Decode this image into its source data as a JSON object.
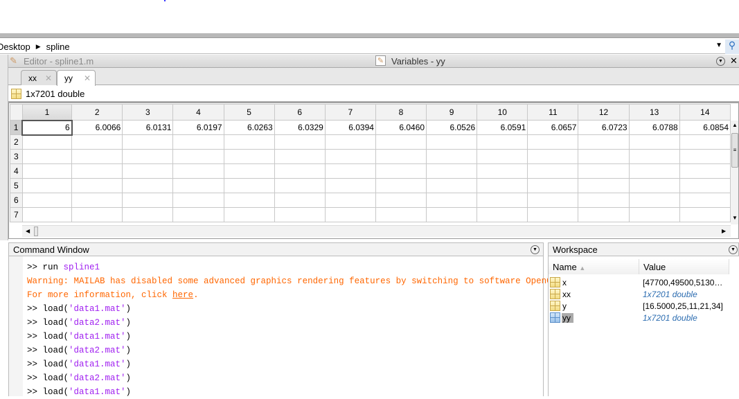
{
  "address": {
    "parts": [
      "Desktop",
      "spline"
    ]
  },
  "editor": {
    "title": "Editor - spline1.m",
    "variables_title": "Variables - yy"
  },
  "tabs": [
    {
      "label": "xx"
    },
    {
      "label": "yy"
    }
  ],
  "variable": {
    "info": "1x7201 double"
  },
  "grid": {
    "columns": [
      "1",
      "2",
      "3",
      "4",
      "5",
      "6",
      "7",
      "8",
      "9",
      "10",
      "11",
      "12",
      "13",
      "14"
    ],
    "rows": [
      "1",
      "2",
      "3",
      "4",
      "5",
      "6",
      "7"
    ],
    "row1": [
      "6",
      "6.0066",
      "6.0131",
      "6.0197",
      "6.0263",
      "6.0329",
      "6.0394",
      "6.0460",
      "6.0526",
      "6.0591",
      "6.0657",
      "6.0723",
      "6.0788",
      "6.0854"
    ]
  },
  "command_window": {
    "title": "Command Window",
    "lines": [
      {
        "prompt": ">> ",
        "cmd": "run ",
        "arg": "spline1"
      },
      {
        "warn": "Warning: MAILAB has disabled some advanced graphics rendering features by switching to software OpenGL."
      },
      {
        "warn": "For more information, click ",
        "link": "here",
        "tail": "."
      },
      {
        "prompt": ">> ",
        "cmd": "load(",
        "arg": "'data1.mat'",
        "close": ")"
      },
      {
        "prompt": ">> ",
        "cmd": "load(",
        "arg": "'data2.mat'",
        "close": ")"
      },
      {
        "prompt": ">> ",
        "cmd": "load(",
        "arg": "'data1.mat'",
        "close": ")"
      },
      {
        "prompt": ">> ",
        "cmd": "load(",
        "arg": "'data2.mat'",
        "close": ")"
      },
      {
        "prompt": ">> ",
        "cmd": "load(",
        "arg": "'data1.mat'",
        "close": ")"
      },
      {
        "prompt": ">> ",
        "cmd": "load(",
        "arg": "'data2.mat'",
        "close": ")"
      },
      {
        "prompt": ">> ",
        "cmd": "load(",
        "arg": "'data1.mat'",
        "close": ")"
      }
    ]
  },
  "workspace": {
    "title": "Workspace",
    "col_name": "Name",
    "col_value": "Value",
    "items": [
      {
        "name": "x",
        "value": "[47700,49500,5130…",
        "italic": false
      },
      {
        "name": "xx",
        "value": "1x7201 double",
        "italic": true
      },
      {
        "name": "y",
        "value": "[16.5000,25,11,21,34]",
        "italic": false
      },
      {
        "name": "yy",
        "value": "1x7201 double",
        "italic": true
      }
    ]
  }
}
